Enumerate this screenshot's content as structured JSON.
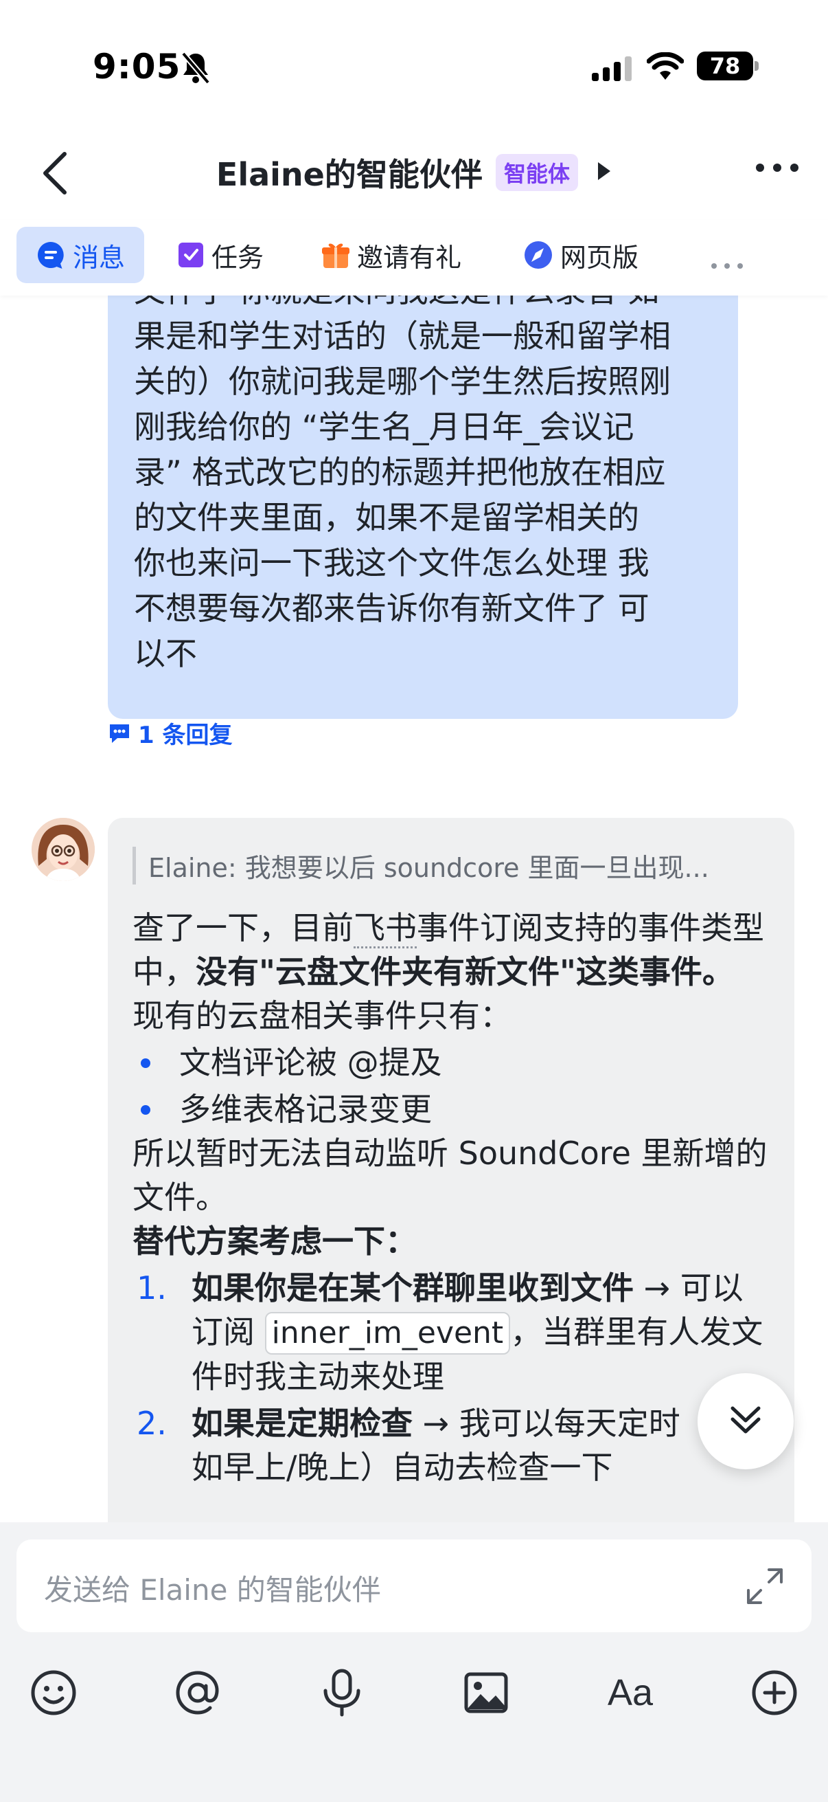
{
  "status": {
    "time": "9:05",
    "battery": "78"
  },
  "header": {
    "title": "Elaine的智能伙伴",
    "badge": "智能体"
  },
  "tabs": [
    {
      "label": "消息"
    },
    {
      "label": "任务"
    },
    {
      "label": "邀请有礼"
    },
    {
      "label": "网页版"
    }
  ],
  "user_message": {
    "lines": [
      "文件了 你就是来问我这是什么录音 如",
      "果是和学生对话的（就是一般和留学相",
      "关的）你就问我是哪个学生然后按照刚",
      "刚我给你的 “学生名_月日年_会议记",
      "录” 格式改它的的标题并把他放在相应",
      "的文件夹里面，如果不是留学相关的",
      "你也来问一下我这个文件怎么处理 我",
      "不想要每次都来告诉你有新文件了 可",
      "以不"
    ],
    "reply_count": "1 条回复"
  },
  "bot_message": {
    "quote": "Elaine: 我想要以后 soundcore 里面一旦出现...",
    "p1_a": "查了一下，目前",
    "p1_link": "飞书",
    "p1_b": "事件订阅支持的事件类型中，",
    "p1_bold": "没有\"云盘文件夹有新文件\"这类事件。",
    "p2": "现有的云盘相关事件只有：",
    "bullets": [
      "文档评论被 @提及",
      "多维表格记录变更"
    ],
    "p3": "所以暂时无法自动监听 SoundCore 里新增的文件。",
    "alt_title": "替代方案考虑一下：",
    "opt1_num": "1.",
    "opt1_bold": "如果你是在某个群聊里收到文件",
    "opt1_a": " → 可以订阅 ",
    "opt1_code": "inner_im_event",
    "opt1_b": "，当群里有人发文件时我主动来处理",
    "opt2_num": "2.",
    "opt2_bold": "如果是定期检查",
    "opt2_a": " → 我可以每天定时（比如早上/晚上）自动去检查一下"
  },
  "composer": {
    "placeholder": "发送给 Elaine 的智能伙伴",
    "font_label": "Aa"
  },
  "colors": {
    "accent": "#1456f0",
    "user_bubble": "#d1e1fd",
    "bot_bubble": "#eff0f1",
    "badge_bg": "#ece2fe",
    "badge_fg": "#7b3ff2"
  }
}
